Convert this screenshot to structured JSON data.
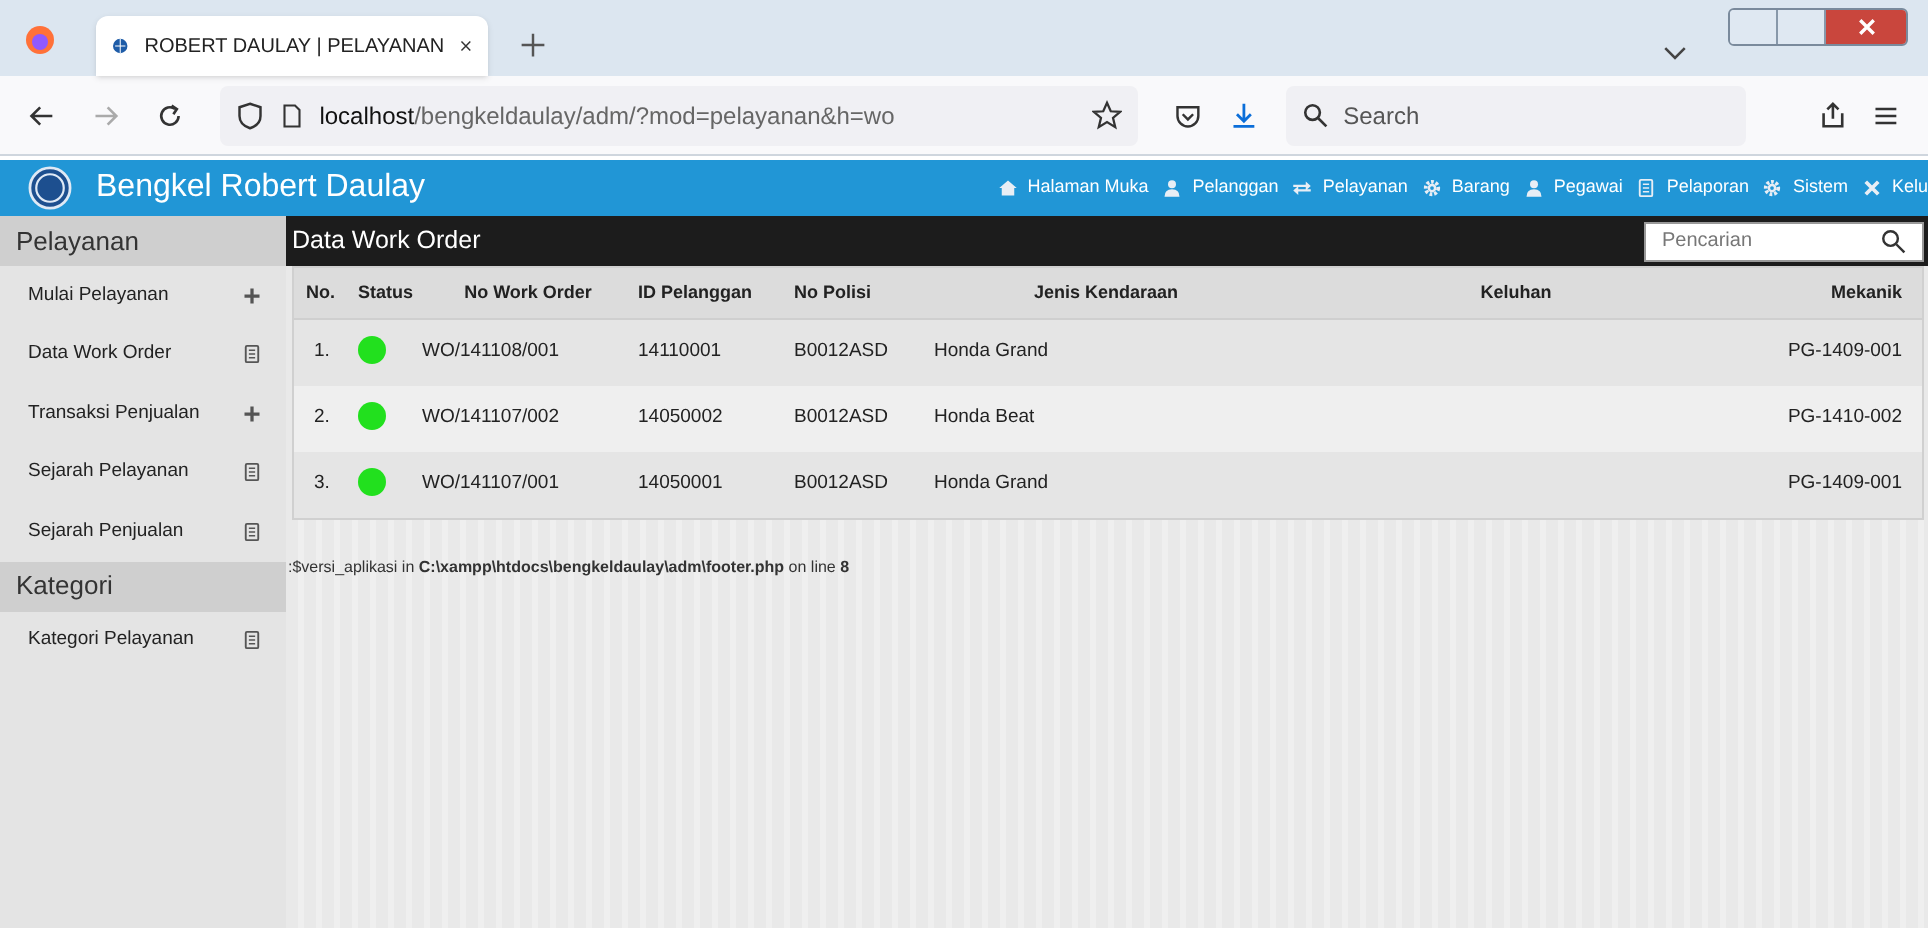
{
  "browser": {
    "tab_title": "ROBERT DAULAY | PELAYANAN",
    "url_host": "localhost",
    "url_path": "/bengkeldaulay/adm/?mod=pelayanan&h=wo",
    "search_placeholder": "Search"
  },
  "app": {
    "title": "Bengkel Robert Daulay",
    "nav": [
      {
        "label": "Halaman Muka",
        "kind": "home"
      },
      {
        "label": "Pelanggan",
        "kind": "person"
      },
      {
        "label": "Pelayanan",
        "kind": "swap"
      },
      {
        "label": "Barang",
        "kind": "gear"
      },
      {
        "label": "Pegawai",
        "kind": "person"
      },
      {
        "label": "Pelaporan",
        "kind": "doc"
      },
      {
        "label": "Sistem",
        "kind": "gear"
      },
      {
        "label": "Kelu",
        "kind": "cross"
      }
    ]
  },
  "sidebar": [
    {
      "title": "Pelayanan",
      "items": [
        {
          "label": "Mulai Pelayanan",
          "kind": "plus"
        },
        {
          "label": "Data Work Order",
          "kind": "doc"
        },
        {
          "label": "Transaksi Penjualan",
          "kind": "plus"
        },
        {
          "label": "Sejarah Pelayanan",
          "kind": "doc"
        },
        {
          "label": "Sejarah Penjualan",
          "kind": "doc"
        }
      ]
    },
    {
      "title": "Kategori",
      "items": [
        {
          "label": "Kategori Pelayanan",
          "kind": "doc"
        }
      ]
    }
  ],
  "panel": {
    "title": "Data Work Order",
    "search_placeholder": "Pencarian"
  },
  "table": {
    "columns": [
      "No.",
      "Status",
      "No Work Order",
      "ID Pelanggan",
      "No Polisi",
      "Jenis Kendaraan",
      "Keluhan",
      "Mekanik"
    ],
    "rows": [
      {
        "no": "1.",
        "color": "#22e01e",
        "work_order": "WO/141108/001",
        "id_pelanggan": "14110001",
        "no_polisi": "B0012ASD",
        "jenis": "Honda Grand",
        "mekanik": "PG-1409-001"
      },
      {
        "no": "2.",
        "color": "#22e01e",
        "work_order": "WO/141107/002",
        "id_pelanggan": "14050002",
        "no_polisi": "B0012ASD",
        "jenis": "Honda Beat",
        "mekanik": "PG-1410-002"
      },
      {
        "no": "3.",
        "color": "#22e01e",
        "work_order": "WO/141107/001",
        "id_pelanggan": "14050001",
        "no_polisi": "B0012ASD",
        "jenis": "Honda Grand",
        "mekanik": "PG-1409-001"
      }
    ]
  },
  "error_text": ":$versi_aplikasi in **C:\\xampp\\htdocs\\bengkeldaulay\\adm\\footer.php** on line **8**"
}
